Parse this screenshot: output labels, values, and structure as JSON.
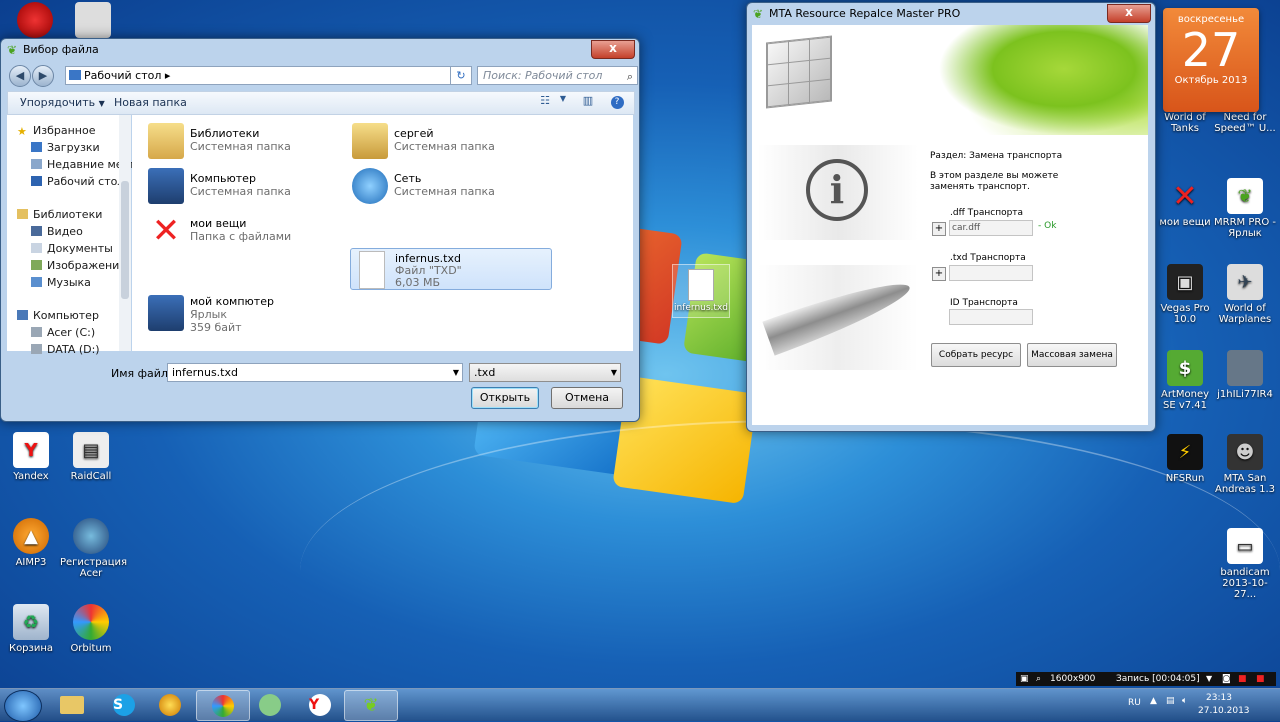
{
  "file_dialog": {
    "title": "Вибор файла",
    "address_path": "Рабочий стол",
    "search_placeholder": "Поиск: Рабочий стол",
    "toolbar": {
      "organize": "Упорядочить",
      "new_folder": "Новая папка"
    },
    "nav": {
      "favorites": "Избранное",
      "downloads": "Загрузки",
      "recent": "Недавние места",
      "desktop": "Рабочий стол",
      "libraries": "Библиотеки",
      "video": "Видео",
      "documents": "Документы",
      "images": "Изображения",
      "music": "Музыка",
      "computer": "Компьютер",
      "drive_c": "Acer (C:)",
      "drive_d": "DATA (D:)"
    },
    "items": [
      {
        "name": "Библиотеки",
        "sub": "Системная папка",
        "sub2": ""
      },
      {
        "name": "сергей",
        "sub": "Системная папка",
        "sub2": ""
      },
      {
        "name": "Компьютер",
        "sub": "Системная папка",
        "sub2": ""
      },
      {
        "name": "Сеть",
        "sub": "Системная папка",
        "sub2": ""
      },
      {
        "name": "мои вещи",
        "sub": "Папка с файлами",
        "sub2": ""
      },
      {
        "name": "infernus.txd",
        "sub": "Файл \"TXD\"",
        "sub2": "6,03 МБ"
      },
      {
        "name": "мой компютер",
        "sub": "Ярлык",
        "sub2": "359 байт"
      }
    ],
    "filename_label": "Имя файла:",
    "filename_value": "infernus.txd",
    "filetype_value": ".txd",
    "open_button": "Открыть",
    "cancel_button": "Отмена"
  },
  "mta_window": {
    "title": "MTA Resource Repalce Master PRO",
    "section_label": "Раздел: Замена транспорта",
    "description": "В этом разделе вы можете заменять транспорт.",
    "dff_label": ".dff Транспорта",
    "dff_value": "car.dff",
    "dff_status": "- Ok",
    "txd_label": ".txd Транспорта",
    "txd_value": "",
    "id_label": "ID Транспорта",
    "id_value": "",
    "plus": "+",
    "build_button": "Собрать ресурс",
    "mass_button": "Массовая замена"
  },
  "calendar": {
    "weekday": "воскресенье",
    "day": "27",
    "month_year": "Октябрь 2013"
  },
  "desktop_icons": [
    {
      "label": "Yandex"
    },
    {
      "label": "RaidCall"
    },
    {
      "label": "AIMP3"
    },
    {
      "label": "Регистрация Acer"
    },
    {
      "label": "Корзина"
    },
    {
      "label": "Orbitum"
    },
    {
      "label": "World of Tanks"
    },
    {
      "label": "Need for Speed™ U..."
    },
    {
      "label": "мои вещи"
    },
    {
      "label": "MRRM PRO - Ярлык"
    },
    {
      "label": "Vegas Pro 10.0"
    },
    {
      "label": "World of Warplanes"
    },
    {
      "label": "ArtMoney SE v7.41"
    },
    {
      "label": "j1hILi77IR4"
    },
    {
      "label": "NFSRun"
    },
    {
      "label": "MTA San Andreas 1.3"
    },
    {
      "label": "bandicam 2013-10-27..."
    }
  ],
  "desktop_file": "infernus.txd",
  "bandicam": {
    "resolution": "1600x900",
    "recording": "Запись [00:04:05]"
  },
  "tray": {
    "lang": "RU",
    "time": "23:13",
    "date": "27.10.2013"
  },
  "close_symbol": "x"
}
